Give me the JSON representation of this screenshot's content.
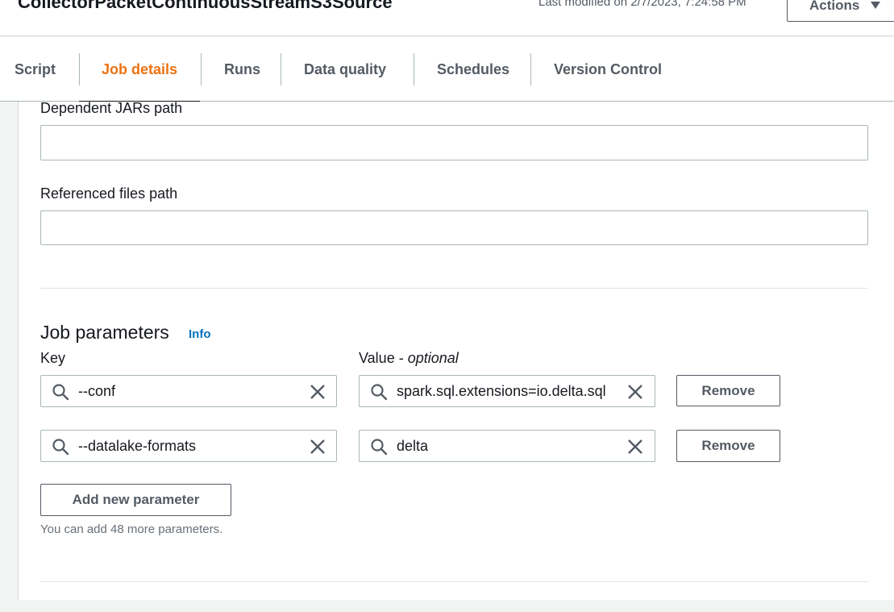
{
  "header": {
    "job_title": "CollectorPacketContinuousStreamS3Source",
    "last_modified": "Last modified on 2/7/2023, 7:24:58 PM",
    "actions_label": "Actions"
  },
  "tabs": [
    {
      "label": "Script",
      "active": false
    },
    {
      "label": "Job details",
      "active": true
    },
    {
      "label": "Runs",
      "active": false
    },
    {
      "label": "Data quality",
      "active": false
    },
    {
      "label": "Schedules",
      "active": false
    },
    {
      "label": "Version Control",
      "active": false
    }
  ],
  "form": {
    "dependent_jars_label": "Dependent JARs path",
    "dependent_jars_value": "",
    "referenced_files_label": "Referenced files path",
    "referenced_files_value": ""
  },
  "job_parameters": {
    "title": "Job parameters",
    "info_label": "Info",
    "key_header": "Key",
    "value_header": "Value - ",
    "value_header_optional": "optional",
    "rows": [
      {
        "key": "--conf",
        "value": "spark.sql.extensions=io.delta.sql",
        "remove_label": "Remove"
      },
      {
        "key": "--datalake-formats",
        "value": "delta",
        "remove_label": "Remove"
      }
    ],
    "add_button_label": "Add new parameter",
    "hint": "You can add 48 more parameters."
  },
  "icons": {
    "search": "search-icon",
    "clear": "close-icon",
    "caret": "caret-down-icon"
  },
  "colors": {
    "active_tab": "#ec7211",
    "info_link": "#0073bb",
    "text": "#16191f",
    "muted": "#545b64"
  }
}
